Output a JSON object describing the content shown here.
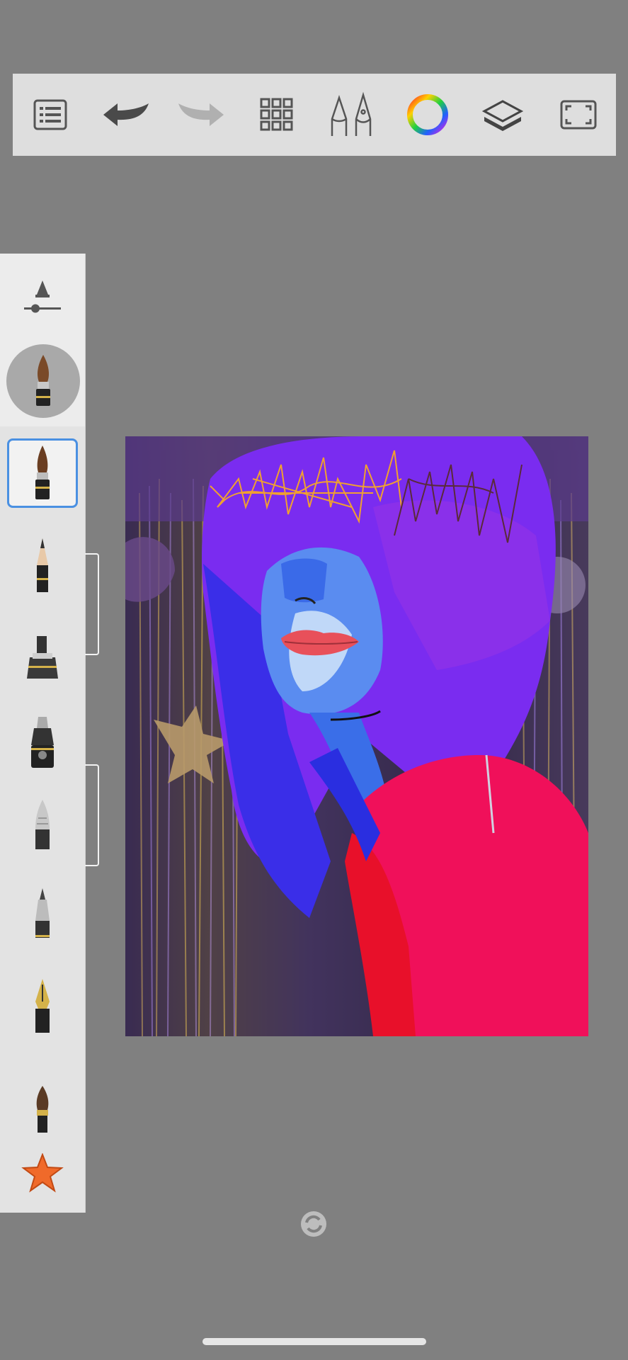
{
  "toolbar": {
    "items": [
      {
        "name": "menu",
        "icon": "list-icon"
      },
      {
        "name": "undo",
        "icon": "undo-arrow-icon"
      },
      {
        "name": "redo",
        "icon": "redo-arrow-icon",
        "disabled": true
      },
      {
        "name": "grid",
        "icon": "grid-icon"
      },
      {
        "name": "brush-library",
        "icon": "brush-pens-icon"
      },
      {
        "name": "color",
        "icon": "color-wheel-icon"
      },
      {
        "name": "layers",
        "icon": "layers-icon"
      },
      {
        "name": "fullscreen",
        "icon": "fullscreen-icon"
      }
    ]
  },
  "brush_palette": {
    "size_control_icon": "brush-size-icon",
    "current_brush_icon": "paintbrush-icon",
    "brushes": [
      {
        "name": "ink-brush",
        "icon": "ink-brush-icon",
        "selected": true
      },
      {
        "name": "pencil",
        "icon": "pencil-icon"
      },
      {
        "name": "marker",
        "icon": "marker-icon"
      },
      {
        "name": "chisel-marker",
        "icon": "chisel-marker-icon"
      },
      {
        "name": "airbrush",
        "icon": "airbrush-icon"
      },
      {
        "name": "ballpoint",
        "icon": "ballpoint-icon"
      },
      {
        "name": "fountain-pen",
        "icon": "fountain-pen-icon"
      },
      {
        "name": "paintbrush",
        "icon": "paintbrush-icon"
      }
    ],
    "favorites_icon": "star-icon",
    "accent_color": "#4a90e2",
    "star_color": "#f06a2a"
  },
  "canvas": {
    "artwork": "digital-painting",
    "colors": {
      "hair": "#7b2cf0",
      "hair_dark": "#2f2ee6",
      "face": "#5a8cf0",
      "lips": "#e8505a",
      "shirt": "#f0105a",
      "scribble": "#f0a030"
    }
  },
  "rotate_icon": "rotate-icon"
}
